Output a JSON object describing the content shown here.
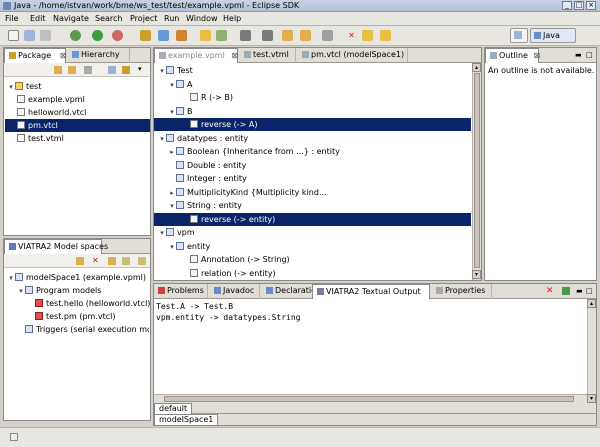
{
  "window": {
    "title": "Java - /home/istvan/work/bme/ws_test/test/example.vpml - Eclipse SDK",
    "min": "_",
    "max": "□",
    "close": "×"
  },
  "menu": [
    "File",
    "Edit",
    "Navigate",
    "Search",
    "Project",
    "Run",
    "Window",
    "Help"
  ],
  "perspective": {
    "label": "Java"
  },
  "package_view": {
    "tabs": [
      "Package",
      "Hierarchy"
    ],
    "items": [
      {
        "label": "test",
        "level": 0,
        "icon": "folder-icon"
      },
      {
        "label": "example.vpml",
        "level": 1,
        "icon": "file-icon"
      },
      {
        "label": "helloworld.vtcl",
        "level": 1,
        "icon": "file-icon"
      },
      {
        "label": "pm.vtcl",
        "level": 1,
        "icon": "file-icon",
        "selected": true
      },
      {
        "label": "test.vtml",
        "level": 1,
        "icon": "file-icon"
      }
    ]
  },
  "editor": {
    "tabs": [
      "example.vpml",
      "test.vtml",
      "pm.vtcl (modelSpace1)"
    ],
    "tree": [
      {
        "label": "Test",
        "level": 0,
        "twisty": "▾"
      },
      {
        "label": "A",
        "level": 1,
        "twisty": "▾"
      },
      {
        "label": "R (-> B)",
        "level": 2,
        "twisty": ""
      },
      {
        "label": "B",
        "level": 1,
        "twisty": "▾"
      },
      {
        "label": "reverse (-> A)",
        "level": 2,
        "twisty": "",
        "selected": true
      },
      {
        "label": "datatypes : entity",
        "level": 0,
        "twisty": "▾"
      },
      {
        "label": "Boolean {Inheritance from ...} : entity",
        "level": 1,
        "twisty": "▸"
      },
      {
        "label": "Double : entity",
        "level": 1,
        "twisty": ""
      },
      {
        "label": "Integer : entity",
        "level": 1,
        "twisty": ""
      },
      {
        "label": "MultiplicityKind {Multiplicity kind...",
        "level": 1,
        "twisty": "▸"
      },
      {
        "label": "String : entity",
        "level": 1,
        "twisty": "▾"
      },
      {
        "label": "reverse (-> entity)",
        "level": 2,
        "twisty": "",
        "selected": true
      },
      {
        "label": "vpm",
        "level": 0,
        "twisty": "▾"
      },
      {
        "label": "entity",
        "level": 1,
        "twisty": "▾"
      },
      {
        "label": "Annotation (-> String)",
        "level": 2,
        "twisty": ""
      },
      {
        "label": "relation (-> entity)",
        "level": 2,
        "twisty": ""
      }
    ]
  },
  "outline": {
    "tab": "Outline",
    "message": "An outline is not available."
  },
  "models_view": {
    "tab": "VIATRA2 Model spaces",
    "items": [
      {
        "label": "modelSpace1 (example.vpml)",
        "level": 0,
        "twisty": "▾"
      },
      {
        "label": "Program models",
        "level": 1,
        "twisty": "▾"
      },
      {
        "label": "test.hello (helloworld.vtcl)",
        "level": 2,
        "twisty": ""
      },
      {
        "label": "test.pm (pm.vtcl)",
        "level": 2,
        "twisty": ""
      },
      {
        "label": "Triggers (serial execution mode",
        "level": 1,
        "twisty": ""
      }
    ]
  },
  "bottom": {
    "tabs": [
      "Problems",
      "Javadoc",
      "Declaration",
      "VIATRA2 Textual Output",
      "Properties"
    ],
    "lines": [
      "Test.A -> Test.B",
      "vpm.entity -> datatypes.String"
    ],
    "subtabs": [
      "default",
      "modelSpace1"
    ]
  },
  "colors": {
    "selection": "#0a246a",
    "chrome": "#d4d0c8"
  }
}
